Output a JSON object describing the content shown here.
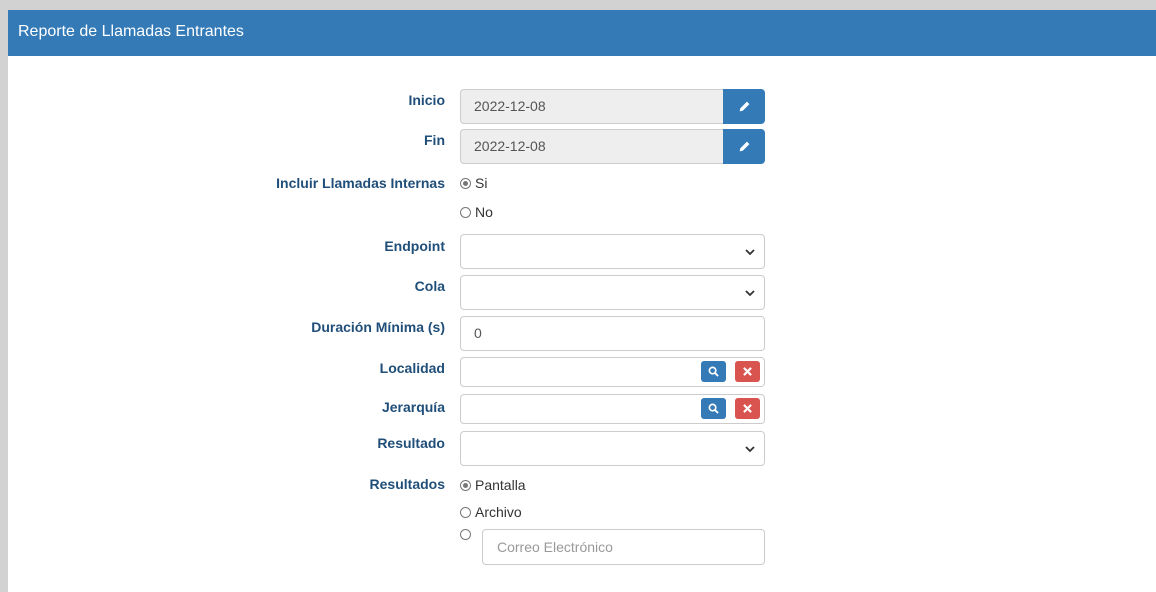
{
  "panel": {
    "title": "Reporte de Llamadas Entrantes"
  },
  "form": {
    "inicio": {
      "label": "Inicio",
      "value": "2022-12-08"
    },
    "fin": {
      "label": "Fin",
      "value": "2022-12-08"
    },
    "internas": {
      "label": "Incluir Llamadas Internas",
      "options": [
        "Si",
        "No"
      ],
      "selected": "Si"
    },
    "endpoint": {
      "label": "Endpoint",
      "value": ""
    },
    "cola": {
      "label": "Cola",
      "value": ""
    },
    "duracion": {
      "label": "Duración Mínima (s)",
      "value": "0"
    },
    "localidad": {
      "label": "Localidad",
      "value": ""
    },
    "jerarquia": {
      "label": "Jerarquía",
      "value": ""
    },
    "resultado": {
      "label": "Resultado",
      "value": ""
    },
    "resultados": {
      "label": "Resultados",
      "options": [
        "Pantalla",
        "Archivo"
      ],
      "selected": "Pantalla",
      "email_placeholder": "Correo Electrónico"
    }
  },
  "colors": {
    "primary": "#337ab7",
    "danger": "#d9534f",
    "label": "#1f4e79"
  },
  "icons": [
    "pencil-icon",
    "chevron-down-icon",
    "search-icon",
    "times-icon"
  ]
}
